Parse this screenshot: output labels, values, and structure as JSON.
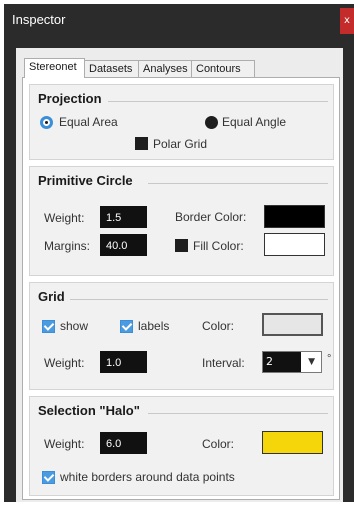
{
  "window": {
    "title": "Inspector",
    "close_glyph": "x"
  },
  "tabs": [
    {
      "label": "Stereonet"
    },
    {
      "label": "Datasets"
    },
    {
      "label": "Analyses"
    },
    {
      "label": "Contours"
    }
  ],
  "projection": {
    "title": "Projection",
    "equal_area": "Equal Area",
    "equal_angle": "Equal Angle",
    "polar_grid": "Polar Grid",
    "selected": "equal_area",
    "polar_grid_checked": false
  },
  "primitive_circle": {
    "title": "Primitive Circle",
    "weight_label": "Weight:",
    "weight": "1.5",
    "margins_label": "Margins:",
    "margins": "40.0",
    "border_color_label": "Border Color:",
    "border_color": "#000000",
    "fill_color_label": "Fill Color:",
    "fill_color": "#ffffff",
    "fill_checked": false
  },
  "grid": {
    "title": "Grid",
    "show_label": "show",
    "show_checked": true,
    "labels_label": "labels",
    "labels_checked": true,
    "color_label": "Color:",
    "color": "#e6e6e6",
    "weight_label": "Weight:",
    "weight": "1.0",
    "interval_label": "Interval:",
    "interval": "2",
    "interval_unit": "°"
  },
  "halo": {
    "title": "Selection \"Halo\"",
    "weight_label": "Weight:",
    "weight": "6.0",
    "color_label": "Color:",
    "color": "#f5d60a",
    "white_borders_label": "white borders around data points",
    "white_borders_checked": true
  },
  "accent": "#3a8fd8"
}
